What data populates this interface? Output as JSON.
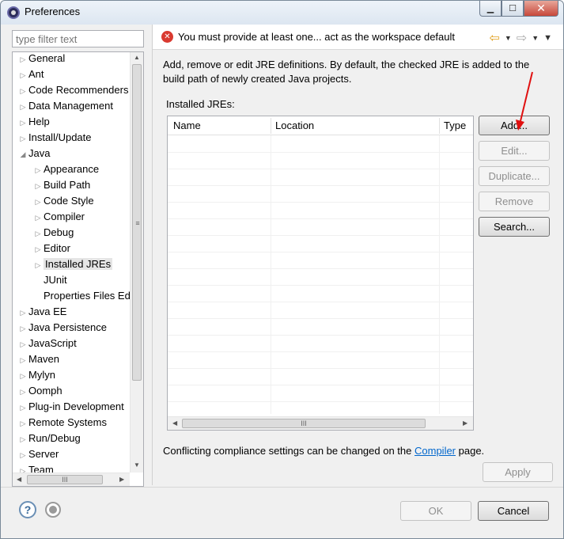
{
  "window": {
    "title": "Preferences"
  },
  "filter": {
    "placeholder": "type filter text"
  },
  "tree": [
    {
      "label": "General",
      "level": 0,
      "expandable": true
    },
    {
      "label": "Ant",
      "level": 0,
      "expandable": true
    },
    {
      "label": "Code Recommenders",
      "level": 0,
      "expandable": true
    },
    {
      "label": "Data Management",
      "level": 0,
      "expandable": true
    },
    {
      "label": "Help",
      "level": 0,
      "expandable": true
    },
    {
      "label": "Install/Update",
      "level": 0,
      "expandable": true
    },
    {
      "label": "Java",
      "level": 0,
      "expandable": true,
      "expanded": true
    },
    {
      "label": "Appearance",
      "level": 1,
      "expandable": true
    },
    {
      "label": "Build Path",
      "level": 1,
      "expandable": true
    },
    {
      "label": "Code Style",
      "level": 1,
      "expandable": true
    },
    {
      "label": "Compiler",
      "level": 1,
      "expandable": true
    },
    {
      "label": "Debug",
      "level": 1,
      "expandable": true
    },
    {
      "label": "Editor",
      "level": 1,
      "expandable": true
    },
    {
      "label": "Installed JREs",
      "level": 1,
      "expandable": true,
      "selected": true
    },
    {
      "label": "JUnit",
      "level": 1,
      "expandable": false
    },
    {
      "label": "Properties Files Ed",
      "level": 1,
      "expandable": false
    },
    {
      "label": "Java EE",
      "level": 0,
      "expandable": true
    },
    {
      "label": "Java Persistence",
      "level": 0,
      "expandable": true
    },
    {
      "label": "JavaScript",
      "level": 0,
      "expandable": true
    },
    {
      "label": "Maven",
      "level": 0,
      "expandable": true
    },
    {
      "label": "Mylyn",
      "level": 0,
      "expandable": true
    },
    {
      "label": "Oomph",
      "level": 0,
      "expandable": true
    },
    {
      "label": "Plug-in Development",
      "level": 0,
      "expandable": true
    },
    {
      "label": "Remote Systems",
      "level": 0,
      "expandable": true
    },
    {
      "label": "Run/Debug",
      "level": 0,
      "expandable": true
    },
    {
      "label": "Server",
      "level": 0,
      "expandable": true
    },
    {
      "label": "Team",
      "level": 0,
      "expandable": true
    }
  ],
  "header": {
    "error_message": "You must provide at least one... act as the workspace default"
  },
  "page": {
    "description": "Add, remove or edit JRE definitions. By default, the checked JRE is added to the build path of newly created Java projects.",
    "installed_label": "Installed JREs:",
    "columns": [
      "Name",
      "Location",
      "Type"
    ],
    "rows": [],
    "buttons": {
      "add": "Add...",
      "edit": "Edit...",
      "duplicate": "Duplicate...",
      "remove": "Remove",
      "search": "Search..."
    },
    "compiler_note_prefix": "Conflicting compliance settings can be changed on the",
    "compiler_link": "Compiler",
    "compiler_note_suffix": "page.",
    "apply": "Apply"
  },
  "footer": {
    "ok": "OK",
    "cancel": "Cancel"
  },
  "colors": {
    "accent_link": "#0066cc",
    "error": "#d93a30",
    "annotation_arrow": "#e01010"
  }
}
